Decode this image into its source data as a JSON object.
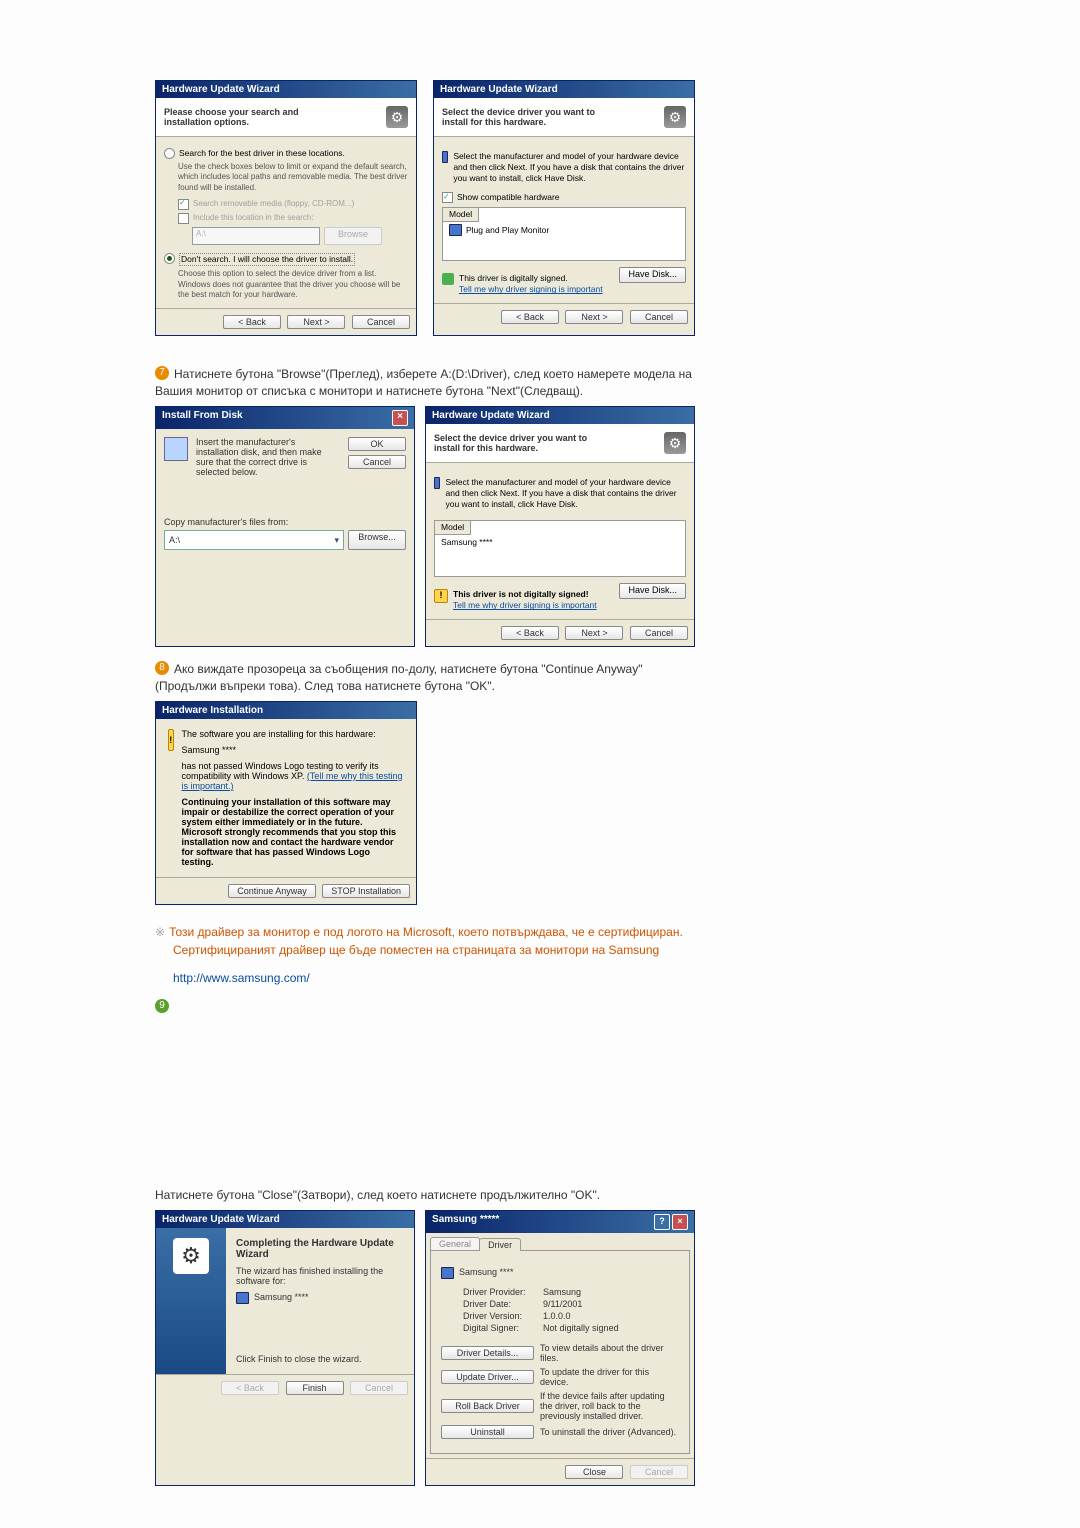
{
  "wizard_title": "Hardware Update Wizard",
  "step7_left": {
    "header": "Please choose your search and installation options.",
    "radio1": "Search for the best driver in these locations.",
    "radio1_desc": "Use the check boxes below to limit or expand the default search, which includes local paths and removable media. The best driver found will be installed.",
    "chk1": "Search removable media (floppy, CD-ROM...)",
    "chk2": "Include this location in the search:",
    "path_value": "A:\\",
    "browse_btn": "Browse",
    "radio2": "Don't search. I will choose the driver to install.",
    "radio2_desc": "Choose this option to select the device driver from a list. Windows does not guarantee that the driver you choose will be the best match for your hardware."
  },
  "nav": {
    "back": "< Back",
    "next": "Next >",
    "cancel": "Cancel",
    "ok": "OK",
    "browse": "Browse...",
    "finish": "Finish",
    "close": "Close"
  },
  "step7_right": {
    "header": "Select the device driver you want to install for this hardware.",
    "desc": "Select the manufacturer and model of your hardware device and then click Next. If you have a disk that contains the driver you want to install, click Have Disk.",
    "show_compat": "Show compatible hardware",
    "model_label": "Model",
    "model_item": "Plug and Play Monitor",
    "signed_msg": "This driver is digitally signed.",
    "signing_link": "Tell me why driver signing is important",
    "have_disk": "Have Disk..."
  },
  "step7_text": "Натиснете бутона \"Browse\"(Преглед), изберете A:(D:\\Driver), след което намерете модела на Вашия монитор от списъка с монитори и натиснете бутона \"Next\"(Следващ).",
  "install_disk": {
    "title": "Install From Disk",
    "msg": "Insert the manufacturer's installation disk, and then make sure that the correct drive is selected below.",
    "copy_from": "Copy manufacturer's files from:",
    "path": "A:\\"
  },
  "right_mid": {
    "model_item": "Samsung ****",
    "not_signed": "This driver is not digitally signed!"
  },
  "step8_text": "Ако виждате прозореца за съобщения по-долу, натиснете бутона \"Continue Anyway\"(Продължи въпреки това). След това натиснете бутона \"OK\".",
  "hw_install": {
    "title": "Hardware Installation",
    "line1": "The software you are installing for this hardware:",
    "device": "Samsung ****",
    "compat": "has not passed Windows Logo testing to verify its compatibility with Windows XP.",
    "compat_link": "(Tell me why this testing is important.)",
    "warn": "Continuing your installation of this software may impair or destabilize the correct operation of your system either immediately or in the future. Microsoft strongly recommends that you stop this installation now and contact the hardware vendor for software that has passed Windows Logo testing.",
    "continue_btn": "Continue Anyway",
    "stop_btn": "STOP Installation"
  },
  "cert_text_1": "Този драйвер за монитор е под логото на Microsoft, което потвърждава, че е сертифициран.",
  "cert_text_2": "Сертифицираният драйвер ще бъде поместен на страницата за монитори на Samsung",
  "samsung_link": "http://www.samsung.com/",
  "step9_text": "Натиснете бутона \"Close\"(Затвори), след което натиснете продължително \"OK\".",
  "completing": {
    "title": "Completing the Hardware Update Wizard",
    "done": "The wizard has finished installing the software for:",
    "device": "Samsung ****",
    "finish_hint": "Click Finish to close the wizard."
  },
  "props": {
    "win_title": "Samsung *****",
    "tab_general": "General",
    "tab_driver": "Driver",
    "device": "Samsung ****",
    "provider_label": "Driver Provider:",
    "provider": "Samsung",
    "date_label": "Driver Date:",
    "date": "9/11/2001",
    "version_label": "Driver Version:",
    "version": "1.0.0.0",
    "signer_label": "Digital Signer:",
    "signer": "Not digitally signed",
    "details_btn": "Driver Details...",
    "details_desc": "To view details about the driver files.",
    "update_btn": "Update Driver...",
    "update_desc": "To update the driver for this device.",
    "rollback_btn": "Roll Back Driver",
    "rollback_desc": "If the device fails after updating the driver, roll back to the previously installed driver.",
    "uninstall_btn": "Uninstall",
    "uninstall_desc": "To uninstall the driver (Advanced)."
  }
}
